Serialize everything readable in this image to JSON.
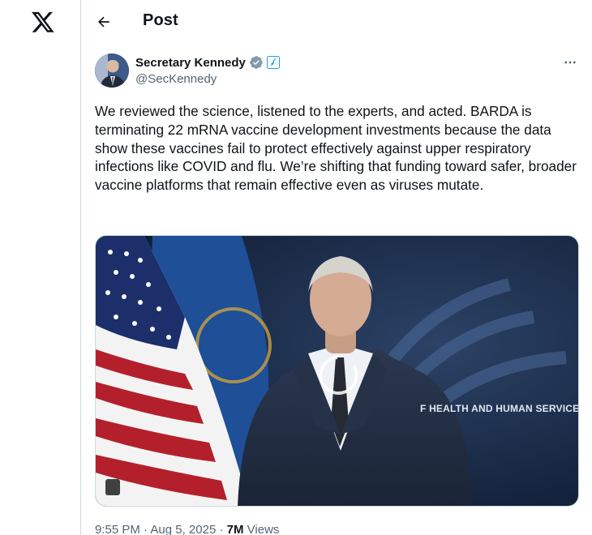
{
  "nav": {
    "logo_icon": "x-logo-icon"
  },
  "header": {
    "back_icon": "arrow-left-icon",
    "title": "Post"
  },
  "post": {
    "author": {
      "display_name": "Secretary Kennedy",
      "handle": "@SecKennedy",
      "verified_badge_color": "#829aab",
      "gov_badge_color": "#1d9bf0"
    },
    "more_icon": "more-horizontal-icon",
    "text": "We reviewed the science, listened to the experts, and acted. BARDA is terminating 22 mRNA vaccine development investments because the data show these vaccines fail to protect effectively against upper respiratory infections like COVID and flu. We’re shifting that funding toward safer, broader vaccine platforms that remain effective even as viruses mutate.",
    "media": {
      "backdrop_text": "F HEALTH AND HUMAN SERVICES"
    },
    "meta": {
      "time": "9:55 PM",
      "separator": "·",
      "date": "Aug 5, 2025",
      "views_count": "7M",
      "views_label": "Views"
    }
  },
  "colors": {
    "text_primary": "#0f1419",
    "text_secondary": "#536471",
    "border": "#cfd9de"
  }
}
